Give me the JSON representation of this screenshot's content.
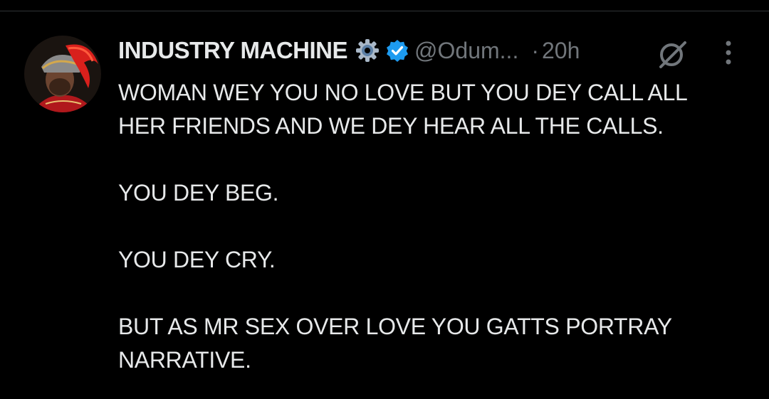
{
  "tweet": {
    "author": {
      "display_name": "INDUSTRY MACHINE",
      "handle": "@Odum...",
      "badges": [
        "gear-icon",
        "verified-icon"
      ]
    },
    "separator": "·",
    "time": "20h",
    "paragraphs": [
      [
        "WOMAN WEY YOU NO LOVE BUT YOU DEY CALL ALL",
        "HER FRIENDS AND WE DEY HEAR ALL THE CALLS."
      ],
      [
        "YOU DEY BEG."
      ],
      [
        "YOU DEY CRY."
      ],
      [
        "BUT AS MR SEX OVER LOVE YOU GATTS PORTRAY",
        "NARRATIVE."
      ]
    ],
    "actions": [
      "grok-icon",
      "more-options-icon"
    ]
  },
  "colors": {
    "background": "#000000",
    "text": "#e7e9ea",
    "secondary_text": "#71767b",
    "verified_blue": "#1d9bf0",
    "divider": "#2f3336"
  }
}
